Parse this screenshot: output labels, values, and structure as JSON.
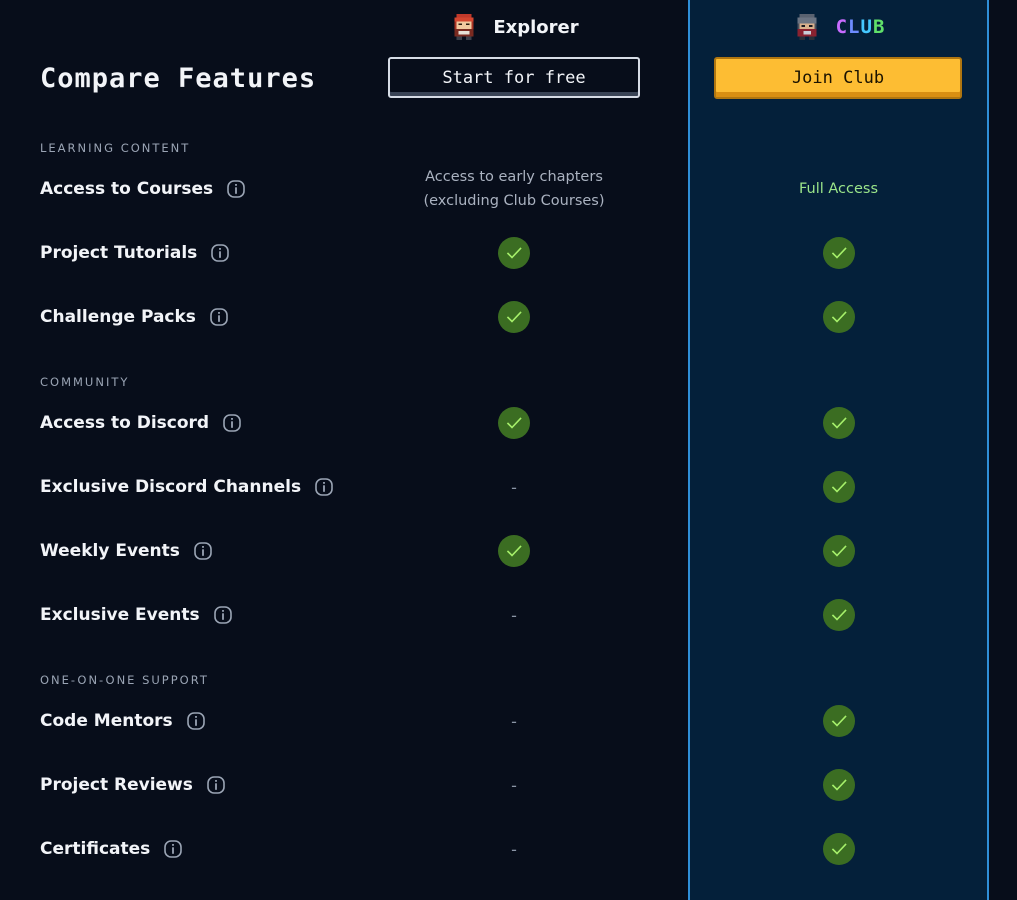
{
  "header": {
    "title": "Compare Features",
    "plans": [
      {
        "name": "Explorer",
        "button": "Start for free",
        "avatar_icon": "red-haired-character-avatar-icon"
      },
      {
        "name": "CLUB",
        "button": "Join Club",
        "avatar_icon": "hooded-character-avatar-icon"
      }
    ]
  },
  "colors": {
    "background": "#070d1a",
    "club_column": "#04203a",
    "club_border": "#2f8fd8",
    "join_button": "#fdbd33",
    "check": "#3b6d22",
    "full_access_text": "#9be58a"
  },
  "sections": [
    {
      "label": "LEARNING CONTENT",
      "features": [
        {
          "label": "Access to Courses",
          "explorer": [
            "Access to early chapters",
            "(excluding Club Courses)"
          ],
          "club": "Full Access"
        },
        {
          "label": "Project Tutorials",
          "explorer": "check",
          "club": "check"
        },
        {
          "label": "Challenge Packs",
          "explorer": "check",
          "club": "check"
        }
      ]
    },
    {
      "label": "COMMUNITY",
      "features": [
        {
          "label": "Access to Discord",
          "explorer": "check",
          "club": "check"
        },
        {
          "label": "Exclusive Discord Channels",
          "explorer": "-",
          "club": "check"
        },
        {
          "label": "Weekly Events",
          "explorer": "check",
          "club": "check"
        },
        {
          "label": "Exclusive Events",
          "explorer": "-",
          "club": "check"
        }
      ]
    },
    {
      "label": "ONE-ON-ONE SUPPORT",
      "features": [
        {
          "label": "Code Mentors",
          "explorer": "-",
          "club": "check"
        },
        {
          "label": "Project Reviews",
          "explorer": "-",
          "club": "check"
        },
        {
          "label": "Certificates",
          "explorer": "-",
          "club": "check"
        }
      ]
    }
  ]
}
